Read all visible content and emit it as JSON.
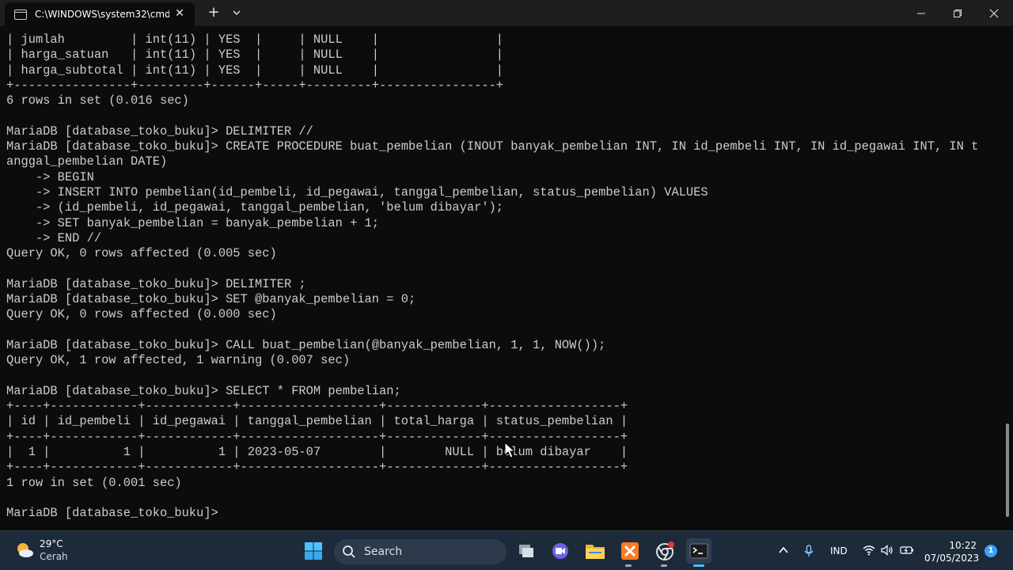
{
  "window": {
    "tab_title": "C:\\WINDOWS\\system32\\cmd.",
    "close_glyph": "✕",
    "new_tab_glyph": "+"
  },
  "terminal": {
    "lines": [
      "| jumlah         | int(11) | YES  |     | NULL    |                |",
      "| harga_satuan   | int(11) | YES  |     | NULL    |                |",
      "| harga_subtotal | int(11) | YES  |     | NULL    |                |",
      "+----------------+---------+------+-----+---------+----------------+",
      "6 rows in set (0.016 sec)",
      "",
      "MariaDB [database_toko_buku]> DELIMITER //",
      "MariaDB [database_toko_buku]> CREATE PROCEDURE buat_pembelian (INOUT banyak_pembelian INT, IN id_pembeli INT, IN id_pegawai INT, IN t",
      "anggal_pembelian DATE)",
      "    -> BEGIN",
      "    -> INSERT INTO pembelian(id_pembeli, id_pegawai, tanggal_pembelian, status_pembelian) VALUES",
      "    -> (id_pembeli, id_pegawai, tanggal_pembelian, 'belum dibayar');",
      "    -> SET banyak_pembelian = banyak_pembelian + 1;",
      "    -> END //",
      "Query OK, 0 rows affected (0.005 sec)",
      "",
      "MariaDB [database_toko_buku]> DELIMITER ;",
      "MariaDB [database_toko_buku]> SET @banyak_pembelian = 0;",
      "Query OK, 0 rows affected (0.000 sec)",
      "",
      "MariaDB [database_toko_buku]> CALL buat_pembelian(@banyak_pembelian, 1, 1, NOW());",
      "Query OK, 1 row affected, 1 warning (0.007 sec)",
      "",
      "MariaDB [database_toko_buku]> SELECT * FROM pembelian;",
      "+----+------------+------------+-------------------+-------------+------------------+",
      "| id | id_pembeli | id_pegawai | tanggal_pembelian | total_harga | status_pembelian |",
      "+----+------------+------------+-------------------+-------------+------------------+",
      "|  1 |          1 |          1 | 2023-05-07        |        NULL | belum dibayar    |",
      "+----+------------+------------+-------------------+-------------+------------------+",
      "1 row in set (0.001 sec)",
      "",
      "MariaDB [database_toko_buku]>"
    ]
  },
  "taskbar": {
    "weather_temp": "29°C",
    "weather_desc": "Cerah",
    "search_label": "Search",
    "language": "IND",
    "time": "10:22",
    "date": "07/05/2023",
    "notification_count": "1",
    "icons": [
      "start-icon",
      "search-icon",
      "task-view-icon",
      "meet-icon",
      "file-explorer-icon",
      "xampp-icon",
      "chrome-icon",
      "terminal-icon"
    ]
  }
}
